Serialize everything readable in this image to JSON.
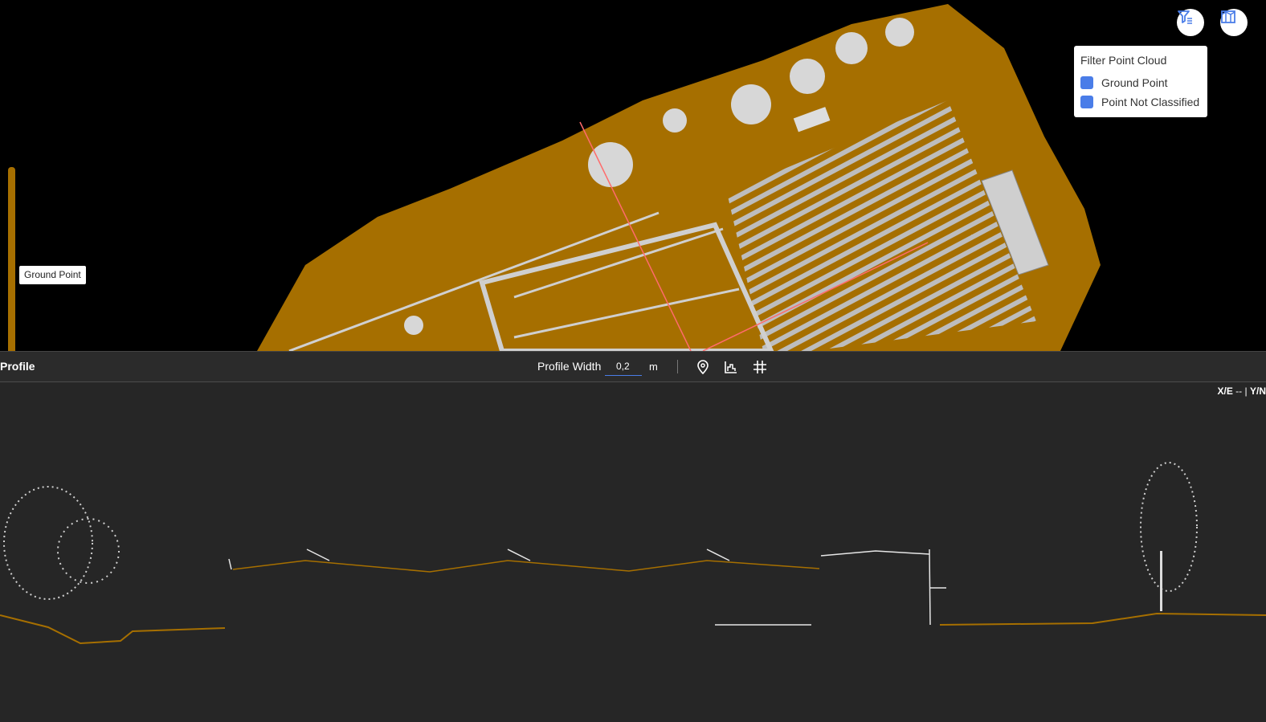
{
  "filter_panel": {
    "title": "Filter Point Cloud",
    "items": [
      {
        "label": "Ground Point",
        "checked": true
      },
      {
        "label": "Point Not Classified",
        "checked": true
      }
    ]
  },
  "toolbar_buttons": {
    "filter_icon": "filter-icon",
    "layers_icon": "map-layers-icon"
  },
  "legend": {
    "label": "Ground Point",
    "color": "#a66f00"
  },
  "profile": {
    "title": "Profile",
    "width_label": "Profile Width",
    "width_value": "0,2",
    "unit": "m",
    "tools": [
      "location-pin-icon",
      "terrain-profile-icon",
      "grid-icon"
    ]
  },
  "coordinates": {
    "x_label": "X/E",
    "x_value": "--",
    "separator": "|",
    "y_label": "Y/N"
  },
  "colors": {
    "ground": "#a66f00",
    "unclassified": "#e8e8e8",
    "accent": "#4a7de8",
    "profile_bg": "#262626",
    "section_line": "#ff6b6b"
  }
}
